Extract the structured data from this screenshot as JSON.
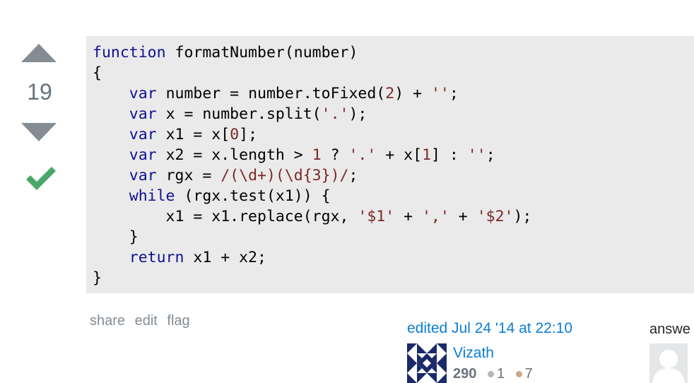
{
  "vote": {
    "count": "19"
  },
  "code": {
    "lines": [
      [
        {
          "t": "kw",
          "v": "function"
        },
        {
          "t": "pln",
          "v": " formatNumber(number)"
        }
      ],
      [
        {
          "t": "pln",
          "v": "{"
        }
      ],
      [
        {
          "t": "pln",
          "v": "    "
        },
        {
          "t": "kw",
          "v": "var"
        },
        {
          "t": "pln",
          "v": " number = number.toFixed("
        },
        {
          "t": "num",
          "v": "2"
        },
        {
          "t": "pln",
          "v": ") + "
        },
        {
          "t": "str",
          "v": "''"
        },
        {
          "t": "pln",
          "v": ";"
        }
      ],
      [
        {
          "t": "pln",
          "v": "    "
        },
        {
          "t": "kw",
          "v": "var"
        },
        {
          "t": "pln",
          "v": " x = number.split("
        },
        {
          "t": "str",
          "v": "'.'"
        },
        {
          "t": "pln",
          "v": ");"
        }
      ],
      [
        {
          "t": "pln",
          "v": "    "
        },
        {
          "t": "kw",
          "v": "var"
        },
        {
          "t": "pln",
          "v": " x1 = x["
        },
        {
          "t": "num",
          "v": "0"
        },
        {
          "t": "pln",
          "v": "];"
        }
      ],
      [
        {
          "t": "pln",
          "v": "    "
        },
        {
          "t": "kw",
          "v": "var"
        },
        {
          "t": "pln",
          "v": " x2 = x.length > "
        },
        {
          "t": "num",
          "v": "1"
        },
        {
          "t": "pln",
          "v": " ? "
        },
        {
          "t": "str",
          "v": "'.'"
        },
        {
          "t": "pln",
          "v": " + x["
        },
        {
          "t": "num",
          "v": "1"
        },
        {
          "t": "pln",
          "v": "] : "
        },
        {
          "t": "str",
          "v": "''"
        },
        {
          "t": "pln",
          "v": ";"
        }
      ],
      [
        {
          "t": "pln",
          "v": "    "
        },
        {
          "t": "kw",
          "v": "var"
        },
        {
          "t": "pln",
          "v": " rgx = "
        },
        {
          "t": "rx",
          "v": "/(\\d+)(\\d{3})/"
        },
        {
          "t": "pln",
          "v": ";"
        }
      ],
      [
        {
          "t": "pln",
          "v": "    "
        },
        {
          "t": "kw",
          "v": "while"
        },
        {
          "t": "pln",
          "v": " (rgx.test(x1)) {"
        }
      ],
      [
        {
          "t": "pln",
          "v": "        x1 = x1.replace(rgx, "
        },
        {
          "t": "str",
          "v": "'$1'"
        },
        {
          "t": "pln",
          "v": " + "
        },
        {
          "t": "str",
          "v": "','"
        },
        {
          "t": "pln",
          "v": " + "
        },
        {
          "t": "str",
          "v": "'$2'"
        },
        {
          "t": "pln",
          "v": ");"
        }
      ],
      [
        {
          "t": "pln",
          "v": "    }"
        }
      ],
      [
        {
          "t": "pln",
          "v": "    "
        },
        {
          "t": "kw",
          "v": "return"
        },
        {
          "t": "pln",
          "v": " x1 + x2;"
        }
      ],
      [
        {
          "t": "pln",
          "v": "}"
        }
      ]
    ]
  },
  "post_menu": {
    "share": "share",
    "edit": "edit",
    "flag": "flag"
  },
  "editor": {
    "edited_text": "edited Jul 24 '14 at 22:10",
    "name": "Vizath",
    "reputation": "290",
    "silver_badges": "1",
    "bronze_badges": "7"
  },
  "answerer": {
    "answered_text": "answe"
  },
  "colors": {
    "accepted": "#48a868",
    "link": "#0c7dd6",
    "code_bg": "#eaeaea",
    "vote_arrow": "#858c93"
  }
}
